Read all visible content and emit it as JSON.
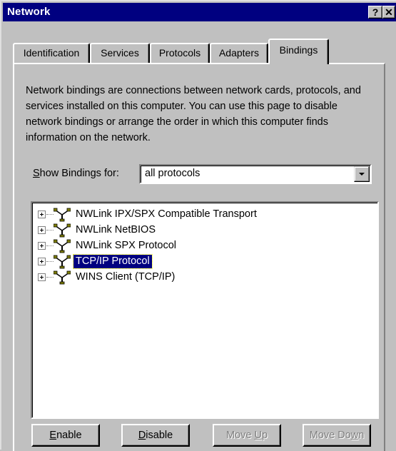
{
  "window": {
    "title": "Network",
    "help_glyph": "?",
    "close_glyph": "✕"
  },
  "tabs": [
    {
      "label": "Identification",
      "active": false
    },
    {
      "label": "Services",
      "active": false
    },
    {
      "label": "Protocols",
      "active": false
    },
    {
      "label": "Adapters",
      "active": false
    },
    {
      "label": "Bindings",
      "active": true
    }
  ],
  "description": "Network bindings are connections between network cards, protocols, and services installed on this computer.  You can use this page to disable network bindings or arrange the order in which this computer finds information on the network.",
  "show_bindings": {
    "label_prefix": "",
    "mnemonic": "S",
    "label_rest": "how Bindings for:",
    "selected": "all protocols"
  },
  "tree": {
    "items": [
      {
        "label": "NWLink IPX/SPX Compatible Transport",
        "selected": false,
        "icon": "network-protocol-icon"
      },
      {
        "label": "NWLink NetBIOS",
        "selected": false,
        "icon": "network-protocol-icon"
      },
      {
        "label": "NWLink SPX Protocol",
        "selected": false,
        "icon": "network-protocol-icon"
      },
      {
        "label": "TCP/IP Protocol",
        "selected": true,
        "icon": "network-protocol-icon"
      },
      {
        "label": "WINS Client (TCP/IP)",
        "selected": false,
        "icon": "network-protocol-icon"
      }
    ]
  },
  "buttons": {
    "enable": {
      "mnemonic": "E",
      "rest": "nable",
      "prefix": "",
      "enabled": true
    },
    "disable": {
      "mnemonic": "D",
      "rest": "isable",
      "prefix": "",
      "enabled": true
    },
    "move_up": {
      "prefix": "Move ",
      "mnemonic": "U",
      "rest": "p",
      "enabled": false
    },
    "move_down": {
      "prefix": "Move Do",
      "mnemonic": "w",
      "rest": "n",
      "enabled": false
    }
  },
  "colors": {
    "titlebar": "#000080",
    "face": "#c0c0c0",
    "selection": "#000080"
  }
}
